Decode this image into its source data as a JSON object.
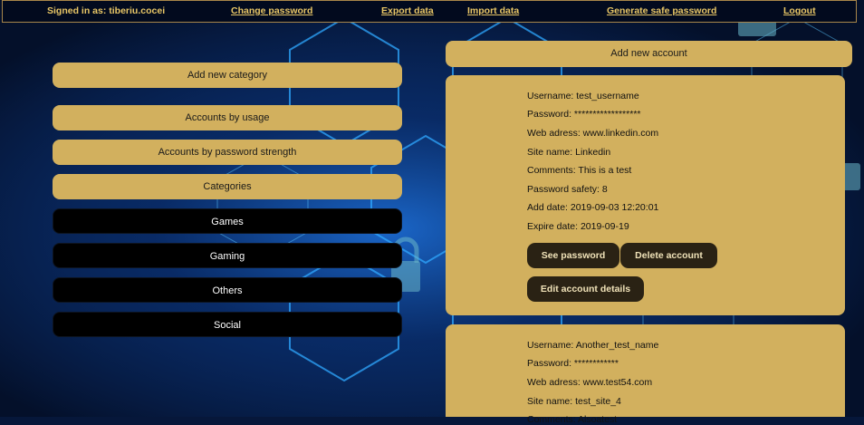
{
  "topbar": {
    "signed_in": "Signed in as: tiberiu.cocei",
    "change_password": "Change password",
    "export_data": "Export data",
    "import_data": "Import data",
    "generate_password": "Generate safe password",
    "logout": "Logout"
  },
  "left_panel": {
    "add_category": "Add new category",
    "accounts_by_usage": "Accounts by usage",
    "accounts_by_strength": "Accounts by password strength",
    "categories_label": "Categories",
    "categories": [
      "Games",
      "Gaming",
      "Others",
      "Social"
    ]
  },
  "right_panel": {
    "add_account": "Add new account",
    "accounts": [
      {
        "username": "Username: test_username",
        "password": "Password: ******************",
        "web": "Web adress: www.linkedin.com",
        "site": "Site name: Linkedin",
        "comments": "Comments: This is a test",
        "safety": "Password safety: 8",
        "add_date": "Add date: 2019-09-03 12:20:01",
        "expire_date": "Expire date: 2019-09-19"
      },
      {
        "username": "Username: Another_test_name",
        "password": "Password: ************",
        "web": "Web adress: www.test54.com",
        "site": "Site name: test_site_4",
        "comments": "Comments: Alsoatest"
      }
    ],
    "see_password": "See password",
    "delete_account": "Delete account",
    "edit_account": "Edit account details"
  },
  "colors": {
    "accent": "#d2b05e",
    "background": "#06173a",
    "dark_button": "#2a2214",
    "link": "#e8c666"
  }
}
